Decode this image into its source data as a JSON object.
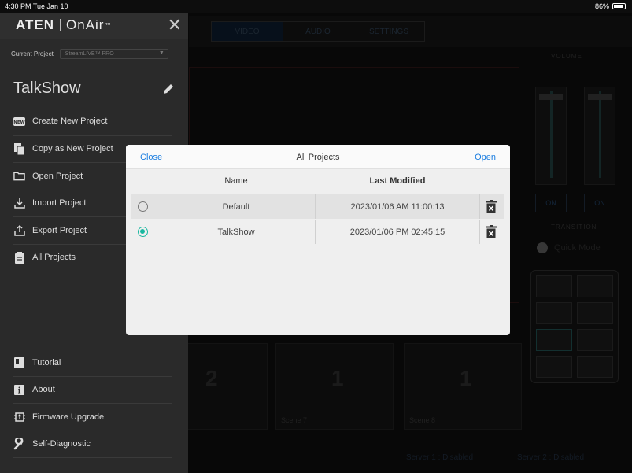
{
  "status_bar": {
    "time": "4:30 PM  Tue Jan 10",
    "battery": "86%"
  },
  "background": {
    "tabs": [
      "VIDEO",
      "AUDIO",
      "SETTINGS"
    ],
    "volume_label": "VOLUME",
    "on_labels": [
      "ON",
      "ON"
    ],
    "transition_label": "TRANSITION",
    "quick_mode": "Quick Mode",
    "scenes": [
      {
        "label": "",
        "number": "2"
      },
      {
        "label": "Scene 7",
        "number": "1"
      },
      {
        "label": "Scene 8",
        "number": "1"
      }
    ],
    "server1": "Server 1 : Disabled",
    "server2": "Server 2 : Disabled"
  },
  "sidebar": {
    "logo": {
      "brand": "ATEN",
      "product": "OnAir",
      "tm": "™"
    },
    "current_project_label": "Current Project",
    "current_project_value": "StreamLIVE™ PRO",
    "project_title": "TalkShow",
    "menu_items": [
      {
        "label": "Create New Project",
        "icon": "new-badge-icon"
      },
      {
        "label": "Copy as New Project",
        "icon": "copy-icon"
      },
      {
        "label": "Open Project",
        "icon": "folder-icon"
      },
      {
        "label": "Import Project",
        "icon": "import-icon"
      },
      {
        "label": "Export Project",
        "icon": "export-icon"
      },
      {
        "label": "All Projects",
        "icon": "clipboard-icon"
      }
    ],
    "bottom_items": [
      {
        "label": "Tutorial",
        "icon": "book-icon"
      },
      {
        "label": "About",
        "icon": "info-icon"
      },
      {
        "label": "Firmware Upgrade",
        "icon": "firmware-icon"
      },
      {
        "label": "Self-Diagnostic",
        "icon": "wrench-icon"
      }
    ]
  },
  "modal": {
    "close_label": "Close",
    "title": "All Projects",
    "open_label": "Open",
    "columns": {
      "name": "Name",
      "last_modified": "Last Modified"
    },
    "rows": [
      {
        "name": "Default",
        "last_modified": "2023/01/06 AM 11:00:13",
        "selected": false
      },
      {
        "name": "TalkShow",
        "last_modified": "2023/01/06 PM 02:45:15",
        "selected": true
      }
    ]
  },
  "colors": {
    "accent_blue": "#1a7de0",
    "selected_teal": "#18b8a0",
    "sidebar_bg": "#2a2a2a"
  }
}
